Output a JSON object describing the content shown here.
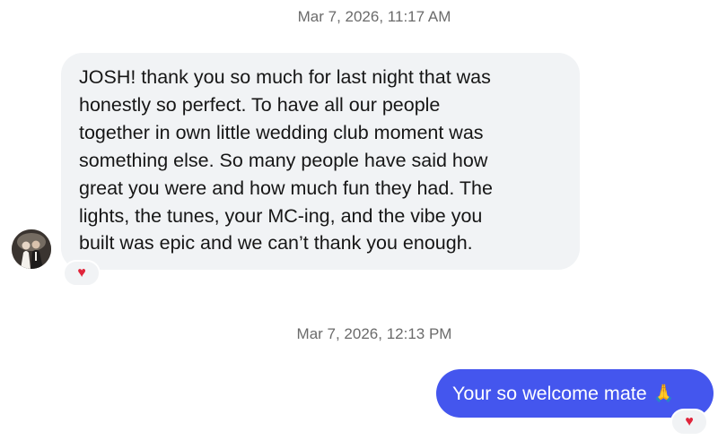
{
  "conversation": {
    "timestamp_1": "Mar 7, 2026, 11:17 AM",
    "incoming_message": "JOSH! thank you so much for last night that was\nhonestly so perfect. To have all our people\ntogether in own little wedding club moment was\nsomething else. So many people have said how\ngreat you were and how much fun they had. The\nlights, the tunes, your MC-ing, and the vibe you\nbuilt was epic and we can’t thank you enough.",
    "incoming_reaction": "♥",
    "timestamp_2": "Mar 7, 2026, 12:13 PM",
    "outgoing_message": "Your so welcome mate",
    "outgoing_emoji": "🙏",
    "outgoing_reaction": "♥"
  },
  "colors": {
    "outgoing_bubble": "#4456ee",
    "incoming_bubble": "#f1f3f5",
    "reaction_heart": "#e0243a",
    "timestamp_text": "#6b6b6b"
  },
  "icons": {
    "avatar": "profile-photo-avatar",
    "reaction": "heart-icon"
  }
}
